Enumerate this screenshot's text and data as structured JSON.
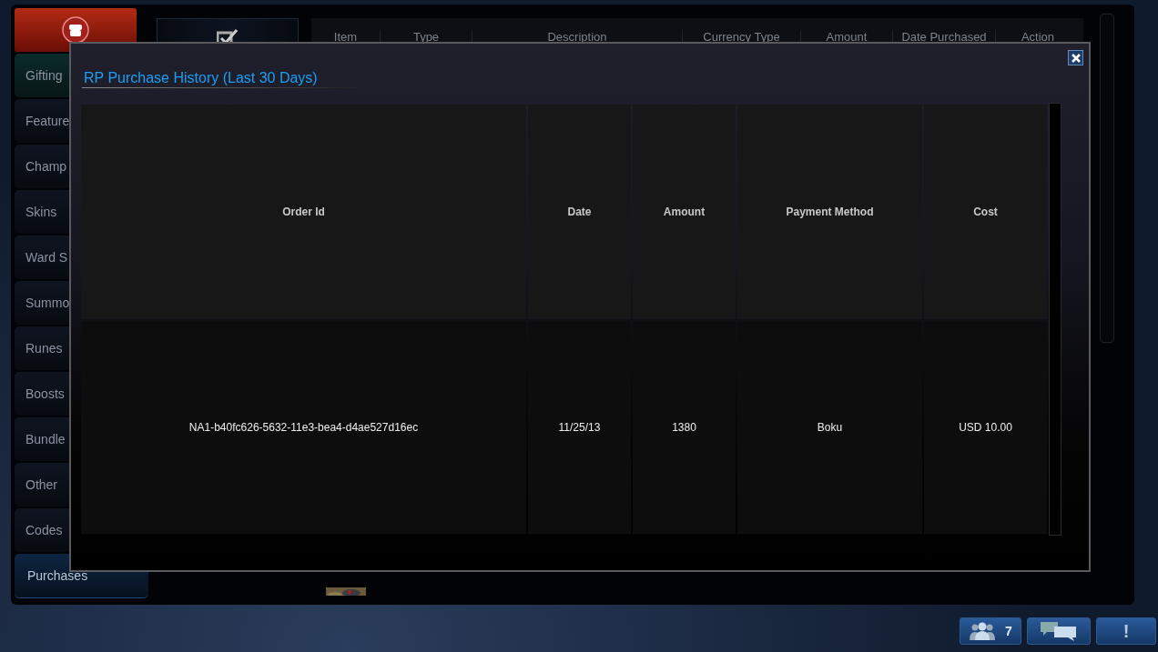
{
  "sidebar": {
    "items": [
      {
        "label": "Gifting",
        "kind": "gifting",
        "selected": false
      },
      {
        "label": "Feature",
        "kind": "category",
        "selected": false
      },
      {
        "label": "Champ",
        "kind": "category",
        "selected": false
      },
      {
        "label": "Skins",
        "kind": "category",
        "selected": false
      },
      {
        "label": "Ward S",
        "kind": "category",
        "selected": false
      },
      {
        "label": "Summo",
        "kind": "category",
        "selected": false
      },
      {
        "label": "Runes",
        "kind": "category",
        "selected": false
      },
      {
        "label": "Boosts",
        "kind": "category",
        "selected": false
      },
      {
        "label": "Bundle",
        "kind": "category",
        "selected": false
      },
      {
        "label": "Other",
        "kind": "category",
        "selected": false
      },
      {
        "label": "Codes",
        "kind": "category",
        "selected": false
      },
      {
        "label": "Purchases",
        "kind": "category",
        "selected": true
      }
    ]
  },
  "history_table": {
    "columns": [
      "Item",
      "Type",
      "Description",
      "Currency Type",
      "Amount",
      "Date Purchased",
      "Action"
    ]
  },
  "dialog": {
    "title": "RP Purchase History (Last 30 Days)",
    "columns": [
      "Order Id",
      "Date",
      "Amount",
      "Payment Method",
      "Cost"
    ],
    "rows": [
      [
        "NA1-b40fc626-5632-11e3-bea4-d4ae527d16ec",
        "11/25/13",
        "1380",
        "Boku",
        "USD 10.00"
      ]
    ]
  },
  "footer": {
    "friends_count": "7",
    "alert_label": "!"
  }
}
